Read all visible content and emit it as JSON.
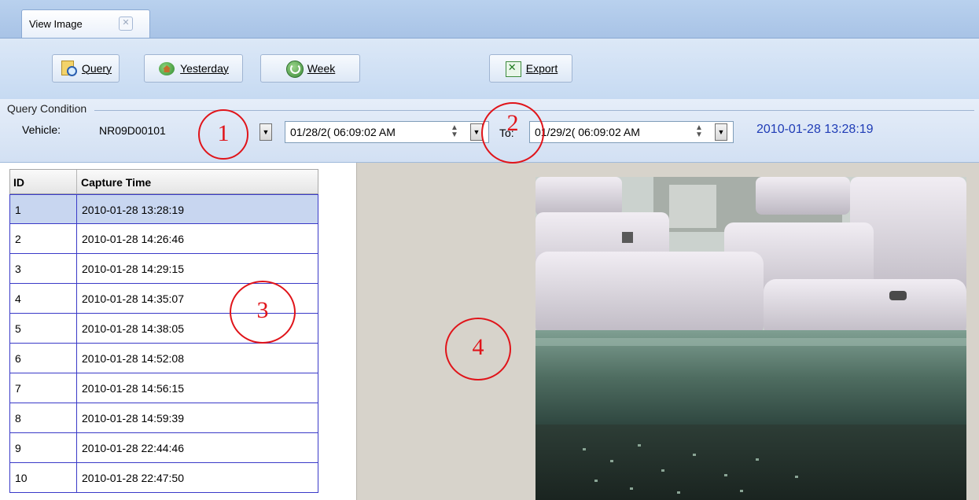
{
  "tab": {
    "label": "View Image",
    "close_glyph": "✕"
  },
  "toolbar": {
    "query": {
      "label": "Query",
      "icon": "query-icon"
    },
    "yesterday": {
      "label": "Yesterday",
      "icon": "home-arrow-icon"
    },
    "week": {
      "label": "Week",
      "icon": "refresh-icon"
    },
    "export": {
      "label": "Export",
      "icon": "excel-export-icon"
    }
  },
  "query_condition": {
    "caption": "Query Condition",
    "vehicle_label": "Vehicle:",
    "vehicle_value": "NR09D00101",
    "from_datetime": "01/28/2( 06:09:02 AM",
    "to_label": "To:",
    "to_datetime": "01/29/2( 06:09:02 AM",
    "current_time": "2010-01-28 13:28:19"
  },
  "table": {
    "columns": [
      "ID",
      "Capture Time"
    ],
    "rows": [
      {
        "id": "1",
        "time": "2010-01-28 13:28:19"
      },
      {
        "id": "2",
        "time": "2010-01-28 14:26:46"
      },
      {
        "id": "3",
        "time": "2010-01-28 14:29:15"
      },
      {
        "id": "4",
        "time": "2010-01-28 14:35:07"
      },
      {
        "id": "5",
        "time": "2010-01-28 14:38:05"
      },
      {
        "id": "6",
        "time": "2010-01-28 14:52:08"
      },
      {
        "id": "7",
        "time": "2010-01-28 14:56:15"
      },
      {
        "id": "8",
        "time": "2010-01-28 14:59:39"
      },
      {
        "id": "9",
        "time": "2010-01-28 22:44:46"
      },
      {
        "id": "10",
        "time": "2010-01-28 22:47:50"
      }
    ],
    "selected_index": 0
  },
  "annotations": [
    "1",
    "2",
    "3",
    "4"
  ],
  "colors": {
    "annotation": "#e0141a",
    "time_text": "#1f3cb6",
    "row_border": "#3a3ac8",
    "selected_row": "#c8d6f0"
  }
}
